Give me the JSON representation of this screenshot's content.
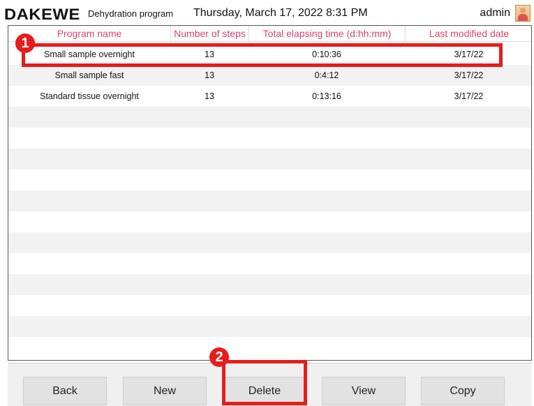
{
  "header": {
    "logo": "DAKEWE",
    "screen_title": "Dehydration program",
    "datetime": "Thursday, March 17, 2022  8:31 PM",
    "user": "admin",
    "avatar_icon": "user-avatar-icon"
  },
  "table": {
    "columns": [
      "Program name",
      "Number of steps",
      "Total elapsing time (d:hh:mm)",
      "Last modified date"
    ],
    "rows": [
      {
        "name": "Small sample overnight",
        "steps": "13",
        "time": "0:10:36",
        "date": "3/17/22"
      },
      {
        "name": "Small sample fast",
        "steps": "13",
        "time": "0:4:12",
        "date": "3/17/22"
      },
      {
        "name": "Standard tissue overnight",
        "steps": "13",
        "time": "0:13:16",
        "date": "3/17/22"
      }
    ],
    "empty_rows": 12
  },
  "buttons": {
    "back": "Back",
    "new": "New",
    "delete": "Delete",
    "view": "View",
    "copy": "Copy"
  },
  "annotations": {
    "marker_1": "1",
    "marker_2": "2",
    "color": "#e51d1d"
  },
  "colors": {
    "header_text_accent": "#e0406f",
    "stripe": "#f2f2f2"
  }
}
